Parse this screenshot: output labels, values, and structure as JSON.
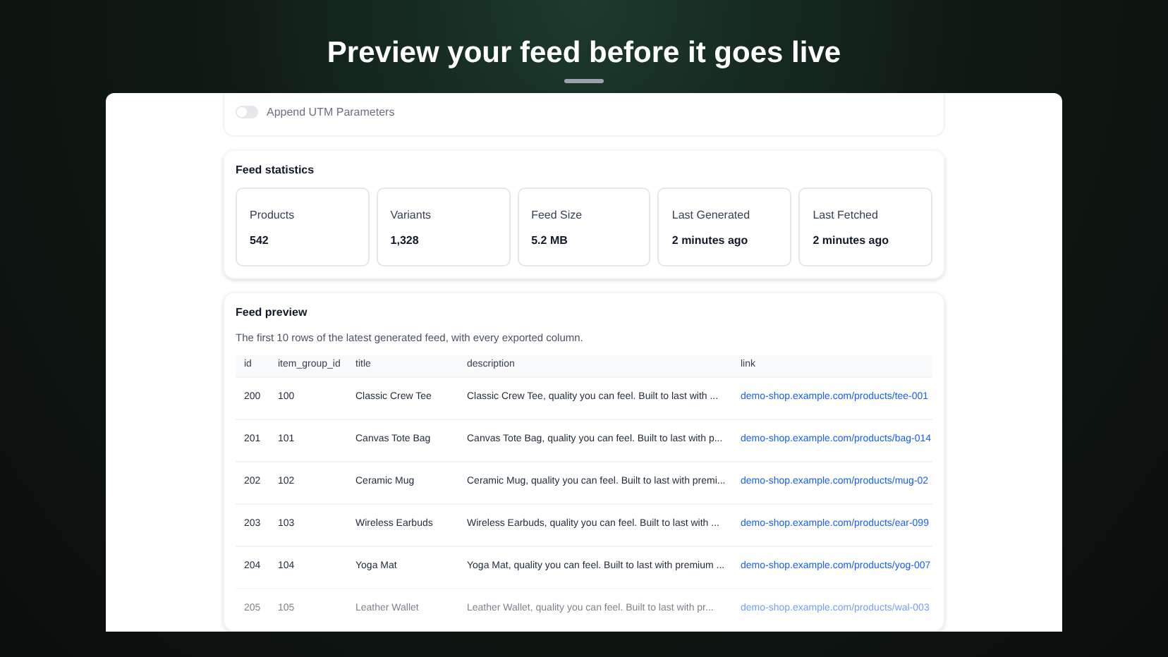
{
  "headline": "Preview your feed before it goes live",
  "utm_toggle": {
    "label": "Append UTM Parameters",
    "on": false,
    "disabled": true
  },
  "statistics": {
    "title": "Feed statistics",
    "items": [
      {
        "label": "Products",
        "value": "542"
      },
      {
        "label": "Variants",
        "value": "1,328"
      },
      {
        "label": "Feed Size",
        "value": "5.2 MB"
      },
      {
        "label": "Last Generated",
        "value": "2 minutes ago"
      },
      {
        "label": "Last Fetched",
        "value": "2 minutes ago"
      }
    ]
  },
  "preview": {
    "title": "Feed preview",
    "subtitle": "The first 10 rows of the latest generated feed, with every exported column.",
    "columns": [
      "id",
      "item_group_id",
      "title",
      "description",
      "link"
    ],
    "rows": [
      {
        "cells": [
          "200",
          "100",
          "Classic Crew Tee",
          "Classic Crew Tee, quality you can feel. Built to last with ...",
          "demo-shop.example.com/products/tee-001"
        ],
        "faded": false
      },
      {
        "cells": [
          "201",
          "101",
          "Canvas Tote Bag",
          "Canvas Tote Bag, quality you can feel. Built to last with p...",
          "demo-shop.example.com/products/bag-014"
        ],
        "faded": false
      },
      {
        "cells": [
          "202",
          "102",
          "Ceramic Mug",
          "Ceramic Mug, quality you can feel. Built to last with premi...",
          "demo-shop.example.com/products/mug-02"
        ],
        "faded": false
      },
      {
        "cells": [
          "203",
          "103",
          "Wireless Earbuds",
          "Wireless Earbuds, quality you can feel. Built to last with ...",
          "demo-shop.example.com/products/ear-099"
        ],
        "faded": false
      },
      {
        "cells": [
          "204",
          "104",
          "Yoga Mat",
          "Yoga Mat, quality you can feel. Built to last with premium ...",
          "demo-shop.example.com/products/yog-007"
        ],
        "faded": false
      },
      {
        "cells": [
          "205",
          "105",
          "Leather Wallet",
          "Leather Wallet, quality you can feel. Built to last with pr...",
          "demo-shop.example.com/products/wal-003"
        ],
        "faded": true
      }
    ]
  }
}
